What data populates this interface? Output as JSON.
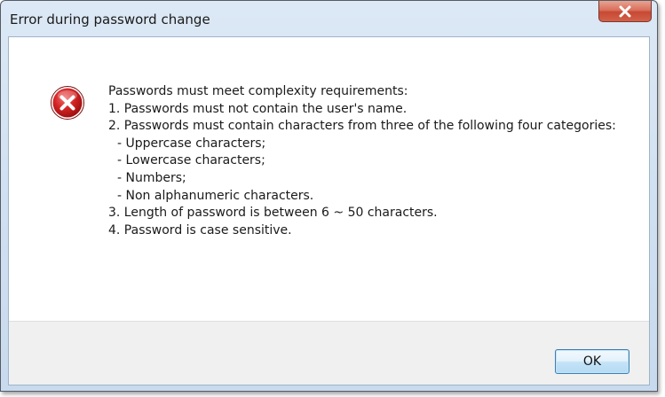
{
  "dialog": {
    "title": "Error during password change",
    "close_glyph": "x",
    "icon": "error-icon",
    "message_lines": [
      "Passwords must meet complexity requirements:",
      "1. Passwords must not contain the user's name.",
      "2. Passwords must contain characters from three of the following four categories:",
      "- Uppercase characters;",
      "- Lowercase characters;",
      "- Numbers;",
      "- Non alphanumeric characters.",
      "3. Length of password is between 6 ~ 50 characters.",
      "4. Password is case sensitive."
    ],
    "ok_label": "OK"
  },
  "colors": {
    "close_button": "#c74a33",
    "error_icon": "#d02020",
    "ok_border": "#3c7fb1",
    "footer_bg": "#f0f0f0"
  }
}
